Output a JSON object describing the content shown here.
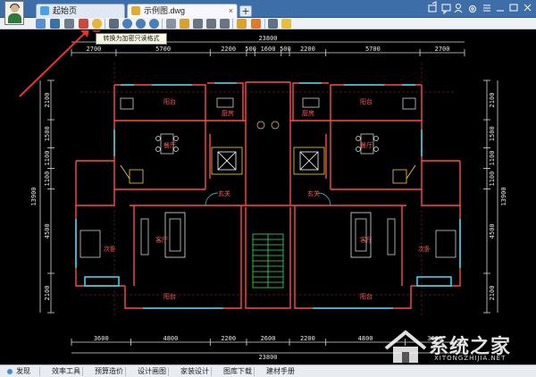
{
  "window": {
    "tabs": [
      {
        "label": "起始页"
      },
      {
        "label": "示例图.dwg"
      }
    ],
    "add_tab": "+"
  },
  "toolbar": {
    "tooltip": "转换为加密只读格式"
  },
  "drawing": {
    "dims_top": {
      "overall": "23800",
      "segments": [
        "2700",
        "5700",
        "2200",
        "500",
        "1600",
        "500",
        "2200",
        "5700",
        "2700"
      ]
    },
    "dims_bottom": {
      "overall": "23800",
      "segments": [
        "3600",
        "4800",
        "2200",
        "2600",
        "2200",
        "4800",
        "3600"
      ]
    },
    "dims_left": {
      "overall": "13900",
      "segments": [
        "2100",
        "1500",
        "1100",
        "1100",
        "4500",
        "2100"
      ]
    },
    "dims_right": {
      "overall": "13900",
      "segments": [
        "2100",
        "1500",
        "1100",
        "1100",
        "4500",
        "2100"
      ]
    },
    "rooms": {
      "balcony": "阳台",
      "kitchen": "厨房",
      "dining": "餐厅",
      "entrance": "玄关",
      "living": "客厅",
      "bedroom": "次卧"
    }
  },
  "statusbar": {
    "items": [
      "发现",
      "效率工具",
      "预算造价",
      "设计画图",
      "家装设计",
      "图库下载",
      "建材手册"
    ]
  },
  "watermark": {
    "title": "系统之家",
    "url": "XITONGZHIJIA.NET"
  }
}
